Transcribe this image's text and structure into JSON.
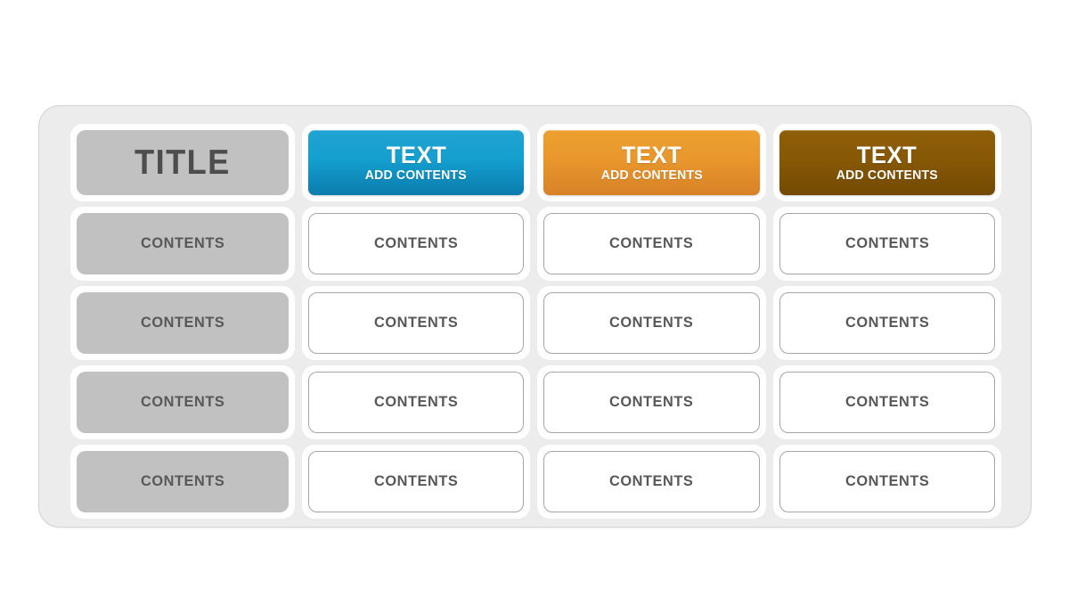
{
  "panel": {
    "background_color": "#ececec",
    "border_color": "#d3d3d3"
  },
  "header": {
    "title_cell": {
      "label": "TITLE",
      "background_color": "#c1c1c1",
      "text_color": "#4d4d4d"
    },
    "columns": [
      {
        "main": "TEXT",
        "sub": "ADD CONTENTS",
        "color_top": "#21a3d2",
        "color_bottom": "#0a7cad",
        "text_color": "#ffffff"
      },
      {
        "main": "TEXT",
        "sub": "ADD CONTENTS",
        "color_top": "#eda02f",
        "color_bottom": "#d88127",
        "text_color": "#ffffff"
      },
      {
        "main": "TEXT",
        "sub": "ADD CONTENTS",
        "color_top": "#8f5e07",
        "color_bottom": "#734a04",
        "text_color": "#ffffff"
      }
    ]
  },
  "body": {
    "label_background_color": "#c1c1c1",
    "data_background_color": "#ffffff",
    "data_border_color": "#a6a6a6",
    "text_color": "#585858",
    "rows": [
      {
        "label": "CONTENTS",
        "cells": [
          "CONTENTS",
          "CONTENTS",
          "CONTENTS"
        ]
      },
      {
        "label": "CONTENTS",
        "cells": [
          "CONTENTS",
          "CONTENTS",
          "CONTENTS"
        ]
      },
      {
        "label": "CONTENTS",
        "cells": [
          "CONTENTS",
          "CONTENTS",
          "CONTENTS"
        ]
      },
      {
        "label": "CONTENTS",
        "cells": [
          "CONTENTS",
          "CONTENTS",
          "CONTENTS"
        ]
      }
    ]
  }
}
